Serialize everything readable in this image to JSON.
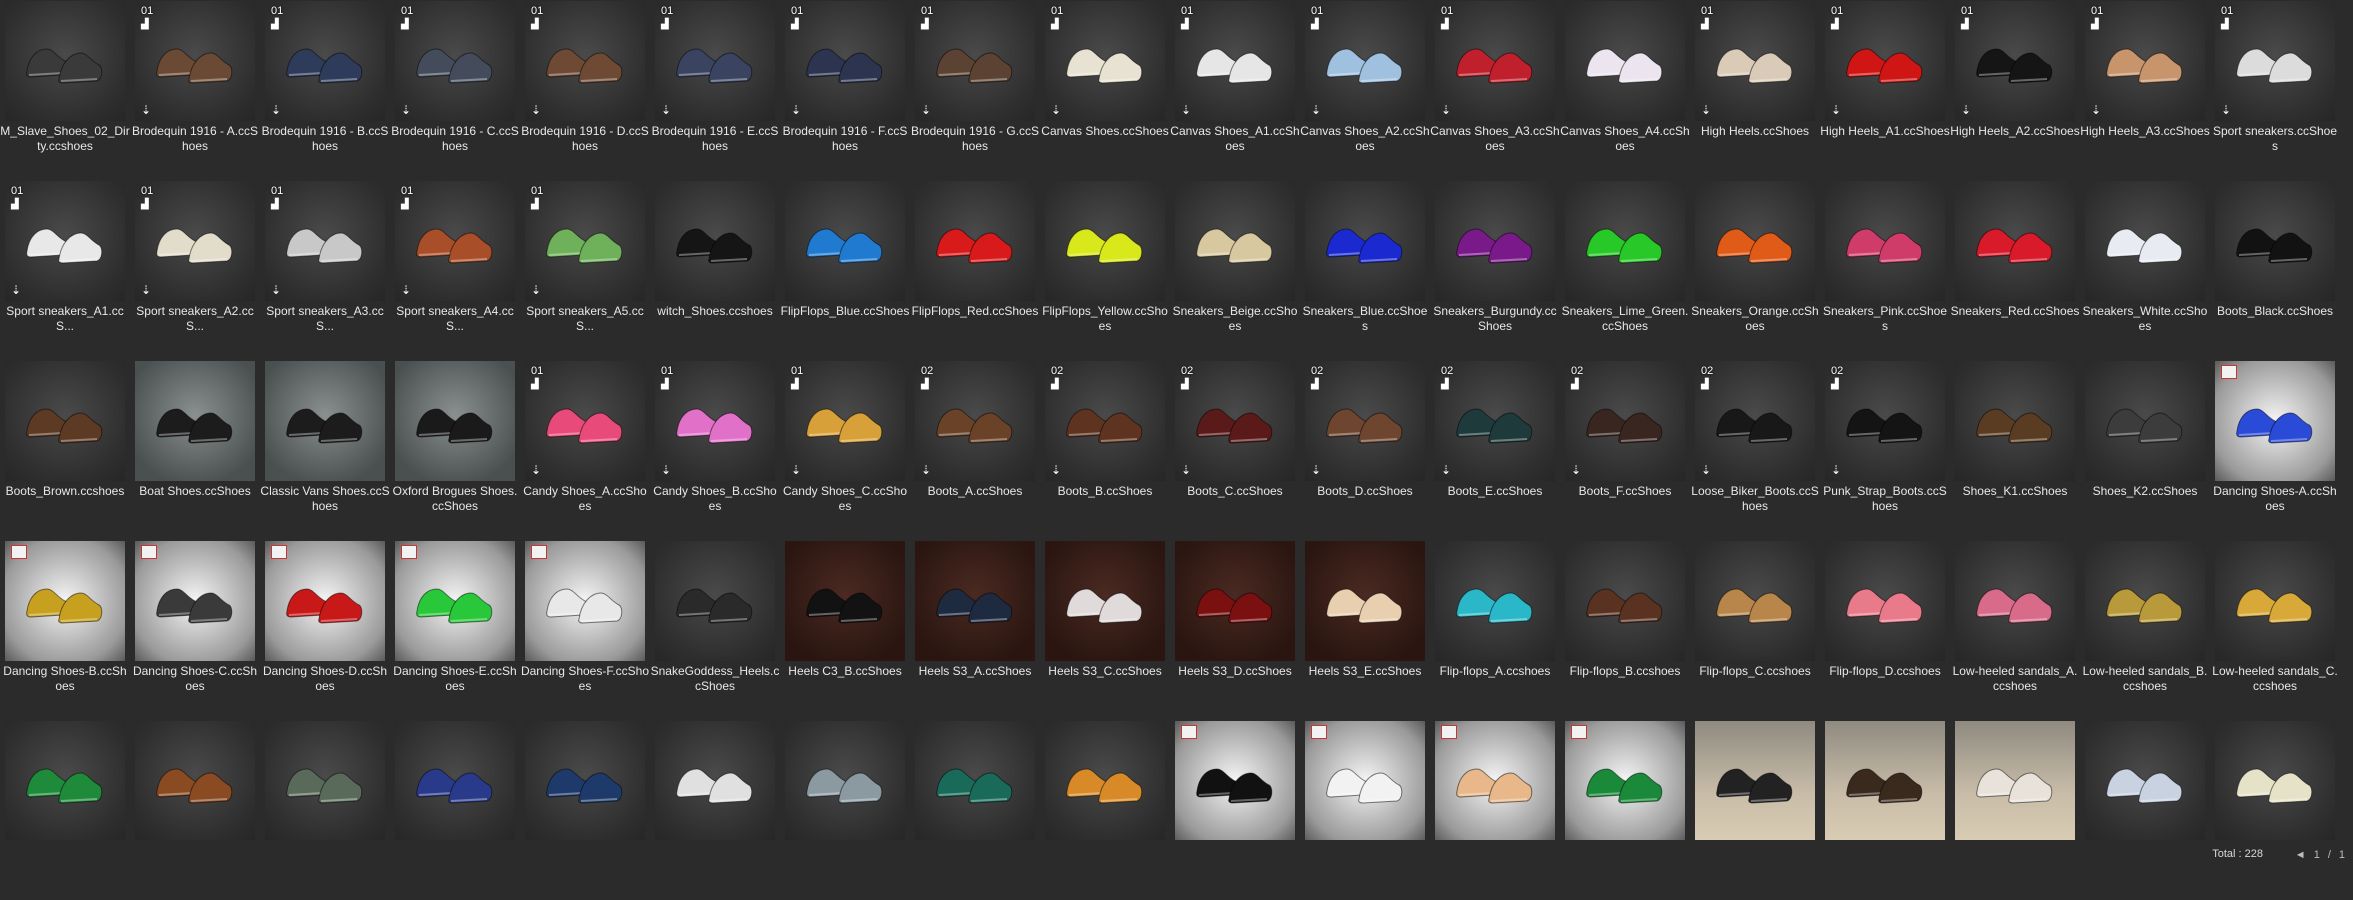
{
  "items": [
    {
      "label": "M_Slave_Shoes_02_Dirty.ccshoes",
      "badge": "",
      "color": "#3a3a3a",
      "bg": "dark"
    },
    {
      "label": "Brodequin 1916 - A.ccShoes",
      "badge": "01",
      "color": "#6b4a35",
      "bg": "dark"
    },
    {
      "label": "Brodequin 1916 - B.ccShoes",
      "badge": "01",
      "color": "#2f3b5a",
      "bg": "dark"
    },
    {
      "label": "Brodequin 1916 - C.ccShoes",
      "badge": "01",
      "color": "#444c5c",
      "bg": "dark"
    },
    {
      "label": "Brodequin 1916 - D.ccShoes",
      "badge": "01",
      "color": "#6e4a35",
      "bg": "dark"
    },
    {
      "label": "Brodequin 1916 - E.ccShoes",
      "badge": "01",
      "color": "#3a4460",
      "bg": "dark"
    },
    {
      "label": "Brodequin 1916 - F.ccShoes",
      "badge": "01",
      "color": "#2c3450",
      "bg": "dark"
    },
    {
      "label": "Brodequin 1916 - G.ccShoes",
      "badge": "01",
      "color": "#5c4232",
      "bg": "dark"
    },
    {
      "label": "Canvas Shoes.ccShoes",
      "badge": "01",
      "color": "#e8e2d2",
      "bg": "dark"
    },
    {
      "label": "Canvas Shoes_A1.ccShoes",
      "badge": "01",
      "color": "#e6e6e6",
      "bg": "dark"
    },
    {
      "label": "Canvas Shoes_A2.ccShoes",
      "badge": "01",
      "color": "#9fc0df",
      "bg": "dark"
    },
    {
      "label": "Canvas Shoes_A3.ccShoes",
      "badge": "01",
      "color": "#c0202c",
      "bg": "dark"
    },
    {
      "label": "Canvas Shoes_A4.ccShoes",
      "badge": "",
      "color": "#ece4ee",
      "bg": "dark"
    },
    {
      "label": "High Heels.ccShoes",
      "badge": "01",
      "color": "#d9cbb8",
      "bg": "dark"
    },
    {
      "label": "High Heels_A1.ccShoes",
      "badge": "01",
      "color": "#d01515",
      "bg": "dark"
    },
    {
      "label": "High Heels_A2.ccShoes",
      "badge": "01",
      "color": "#151515",
      "bg": "dark"
    },
    {
      "label": "High Heels_A3.ccShoes",
      "badge": "01",
      "color": "#c8946c",
      "bg": "dark"
    },
    {
      "label": "Sport sneakers.ccShoes",
      "badge": "01",
      "color": "#dcdcdc",
      "bg": "dark"
    },
    {
      "label": "Sport sneakers_A1.ccS...",
      "badge": "01",
      "color": "#e8e8e8",
      "bg": "dark"
    },
    {
      "label": "Sport sneakers_A2.ccS...",
      "badge": "01",
      "color": "#e2dccb",
      "bg": "dark"
    },
    {
      "label": "Sport sneakers_A3.ccS...",
      "badge": "01",
      "color": "#c8c8c8",
      "bg": "dark"
    },
    {
      "label": "Sport sneakers_A4.ccS...",
      "badge": "01",
      "color": "#a84e28",
      "bg": "dark"
    },
    {
      "label": "Sport sneakers_A5.ccS...",
      "badge": "01",
      "color": "#6fb05a",
      "bg": "dark"
    },
    {
      "label": "witch_Shoes.ccshoes",
      "badge": "",
      "color": "#151515",
      "bg": "dark"
    },
    {
      "label": "FlipFlops_Blue.ccShoes",
      "badge": "",
      "color": "#1f7ad0",
      "bg": "dark"
    },
    {
      "label": "FlipFlops_Red.ccShoes",
      "badge": "",
      "color": "#d81a1a",
      "bg": "dark"
    },
    {
      "label": "FlipFlops_Yellow.ccShoes",
      "badge": "",
      "color": "#d8e81a",
      "bg": "dark"
    },
    {
      "label": "Sneakers_Beige.ccShoes",
      "badge": "",
      "color": "#d8c8a0",
      "bg": "dark"
    },
    {
      "label": "Sneakers_Blue.ccShoes",
      "badge": "",
      "color": "#1a2ad0",
      "bg": "dark"
    },
    {
      "label": "Sneakers_Burgundy.ccShoes",
      "badge": "",
      "color": "#7a1a8a",
      "bg": "dark"
    },
    {
      "label": "Sneakers_Lime_Green.ccShoes",
      "badge": "",
      "color": "#28c828",
      "bg": "dark"
    },
    {
      "label": "Sneakers_Orange.ccShoes",
      "badge": "",
      "color": "#e05a18",
      "bg": "dark"
    },
    {
      "label": "Sneakers_Pink.ccShoes",
      "badge": "",
      "color": "#d03c6a",
      "bg": "dark"
    },
    {
      "label": "Sneakers_Red.ccShoes",
      "badge": "",
      "color": "#d81a2a",
      "bg": "dark"
    },
    {
      "label": "Sneakers_White.ccShoes",
      "badge": "",
      "color": "#e8ecf2",
      "bg": "dark"
    },
    {
      "label": "Boots_Black.ccShoes",
      "badge": "",
      "color": "#121212",
      "bg": "dark"
    },
    {
      "label": "Boots_Brown.ccshoes",
      "badge": "",
      "color": "#5c3a24",
      "bg": "dark"
    },
    {
      "label": "Boat Shoes.ccShoes",
      "badge": "",
      "color": "#1c1c1c",
      "bg": "light"
    },
    {
      "label": "Classic Vans Shoes.ccShoes",
      "badge": "",
      "color": "#1c1c1c",
      "bg": "light"
    },
    {
      "label": "Oxford Brogues Shoes.ccShoes",
      "badge": "",
      "color": "#1a1a1a",
      "bg": "light"
    },
    {
      "label": "Candy Shoes_A.ccShoes",
      "badge": "01",
      "color": "#e84a7a",
      "bg": "dark"
    },
    {
      "label": "Candy Shoes_B.ccShoes",
      "badge": "01",
      "color": "#e070c8",
      "bg": "dark"
    },
    {
      "label": "Candy Shoes_C.ccShoes",
      "badge": "01",
      "color": "#d8a038",
      "bg": "dark"
    },
    {
      "label": "Boots_A.ccShoes",
      "badge": "02",
      "color": "#6a4228",
      "bg": "dark"
    },
    {
      "label": "Boots_B.ccShoes",
      "badge": "02",
      "color": "#5e3420",
      "bg": "dark"
    },
    {
      "label": "Boots_C.ccShoes",
      "badge": "02",
      "color": "#5a1a1a",
      "bg": "dark"
    },
    {
      "label": "Boots_D.ccShoes",
      "badge": "02",
      "color": "#6e4630",
      "bg": "dark"
    },
    {
      "label": "Boots_E.ccShoes",
      "badge": "02",
      "color": "#1e3a3a",
      "bg": "dark"
    },
    {
      "label": "Boots_F.ccShoes",
      "badge": "02",
      "color": "#3a2620",
      "bg": "dark"
    },
    {
      "label": "Loose_Biker_Boots.ccShoes",
      "badge": "02",
      "color": "#181818",
      "bg": "dark"
    },
    {
      "label": "Punk_Strap_Boots.ccShoes",
      "badge": "02",
      "color": "#141414",
      "bg": "dark"
    },
    {
      "label": "Shoes_K1.ccShoes",
      "badge": "",
      "color": "#5a3c22",
      "bg": "dark"
    },
    {
      "label": "Shoes_K2.ccShoes",
      "badge": "",
      "color": "#3c3c3c",
      "bg": "dark"
    },
    {
      "label": "Dancing Shoes-A.ccShoes",
      "badge": "flag",
      "color": "#2a4ad8",
      "bg": "white"
    },
    {
      "label": "Dancing Shoes-B.ccShoes",
      "badge": "flag",
      "color": "#c8a020",
      "bg": "white"
    },
    {
      "label": "Dancing Shoes-C.ccShoes",
      "badge": "flag",
      "color": "#3a3a3a",
      "bg": "white"
    },
    {
      "label": "Dancing Shoes-D.ccShoes",
      "badge": "flag",
      "color": "#c81818",
      "bg": "white"
    },
    {
      "label": "Dancing Shoes-E.ccShoes",
      "badge": "flag",
      "color": "#28c83a",
      "bg": "white"
    },
    {
      "label": "Dancing Shoes-F.ccShoes",
      "badge": "flag",
      "color": "#e8e8e8",
      "bg": "white"
    },
    {
      "label": "SnakeGoddess_Heels.ccShoes",
      "badge": "",
      "color": "#2a2a2a",
      "bg": "dark"
    },
    {
      "label": "Heels C3_B.ccShoes",
      "badge": "",
      "color": "#121212",
      "bg": "brown"
    },
    {
      "label": "Heels S3_A.ccShoes",
      "badge": "",
      "color": "#1e2a40",
      "bg": "brown"
    },
    {
      "label": "Heels S3_C.ccShoes",
      "badge": "",
      "color": "#e0dada",
      "bg": "brown"
    },
    {
      "label": "Heels S3_D.ccShoes",
      "badge": "",
      "color": "#7a1010",
      "bg": "brown"
    },
    {
      "label": "Heels S3_E.ccShoes",
      "badge": "",
      "color": "#e8cfb0",
      "bg": "brown"
    },
    {
      "label": "Flip-flops_A.ccshoes",
      "badge": "",
      "color": "#2ab8c8",
      "bg": "dark"
    },
    {
      "label": "Flip-flops_B.ccshoes",
      "badge": "",
      "color": "#5a3222",
      "bg": "dark"
    },
    {
      "label": "Flip-flops_C.ccshoes",
      "badge": "",
      "color": "#b8864a",
      "bg": "dark"
    },
    {
      "label": "Flip-flops_D.ccshoes",
      "badge": "",
      "color": "#e87a8a",
      "bg": "dark"
    },
    {
      "label": "Low-heeled sandals_A.ccshoes",
      "badge": "",
      "color": "#d86a8a",
      "bg": "dark"
    },
    {
      "label": "Low-heeled sandals_B.ccshoes",
      "badge": "",
      "color": "#b89a3a",
      "bg": "dark"
    },
    {
      "label": "Low-heeled sandals_C.ccshoes",
      "badge": "",
      "color": "#d8a838",
      "bg": "dark"
    },
    {
      "label": "",
      "badge": "",
      "color": "#1e8a3a",
      "bg": "dark"
    },
    {
      "label": "",
      "badge": "",
      "color": "#8a4a22",
      "bg": "dark"
    },
    {
      "label": "",
      "badge": "",
      "color": "#5a6a5a",
      "bg": "dark"
    },
    {
      "label": "",
      "badge": "",
      "color": "#2a3a8a",
      "bg": "dark"
    },
    {
      "label": "",
      "badge": "",
      "color": "#1e3a6a",
      "bg": "dark"
    },
    {
      "label": "",
      "badge": "",
      "color": "#e0e0e0",
      "bg": "dark"
    },
    {
      "label": "",
      "badge": "",
      "color": "#8a9aa0",
      "bg": "dark"
    },
    {
      "label": "",
      "badge": "",
      "color": "#1a6a5a",
      "bg": "dark"
    },
    {
      "label": "",
      "badge": "",
      "color": "#d88a28",
      "bg": "dark"
    },
    {
      "label": "",
      "badge": "flag",
      "color": "#111111",
      "bg": "white"
    },
    {
      "label": "",
      "badge": "flag",
      "color": "#f2f2f2",
      "bg": "white"
    },
    {
      "label": "",
      "badge": "flag",
      "color": "#e8b88a",
      "bg": "white"
    },
    {
      "label": "",
      "badge": "flag",
      "color": "#1a8a3a",
      "bg": "white"
    },
    {
      "label": "",
      "badge": "",
      "color": "#222222",
      "bg": "photo"
    },
    {
      "label": "",
      "badge": "",
      "color": "#3a2a1e",
      "bg": "photo"
    },
    {
      "label": "",
      "badge": "",
      "color": "#e8e2da",
      "bg": "photo"
    },
    {
      "label": "",
      "badge": "",
      "color": "#c8d2e0",
      "bg": "dark"
    },
    {
      "label": "",
      "badge": "",
      "color": "#e6e2c8",
      "bg": "dark"
    }
  ],
  "footer": {
    "total": "Total : 228",
    "prev_icon": "◄",
    "page": "1",
    "sep": "/",
    "pages": "1"
  }
}
